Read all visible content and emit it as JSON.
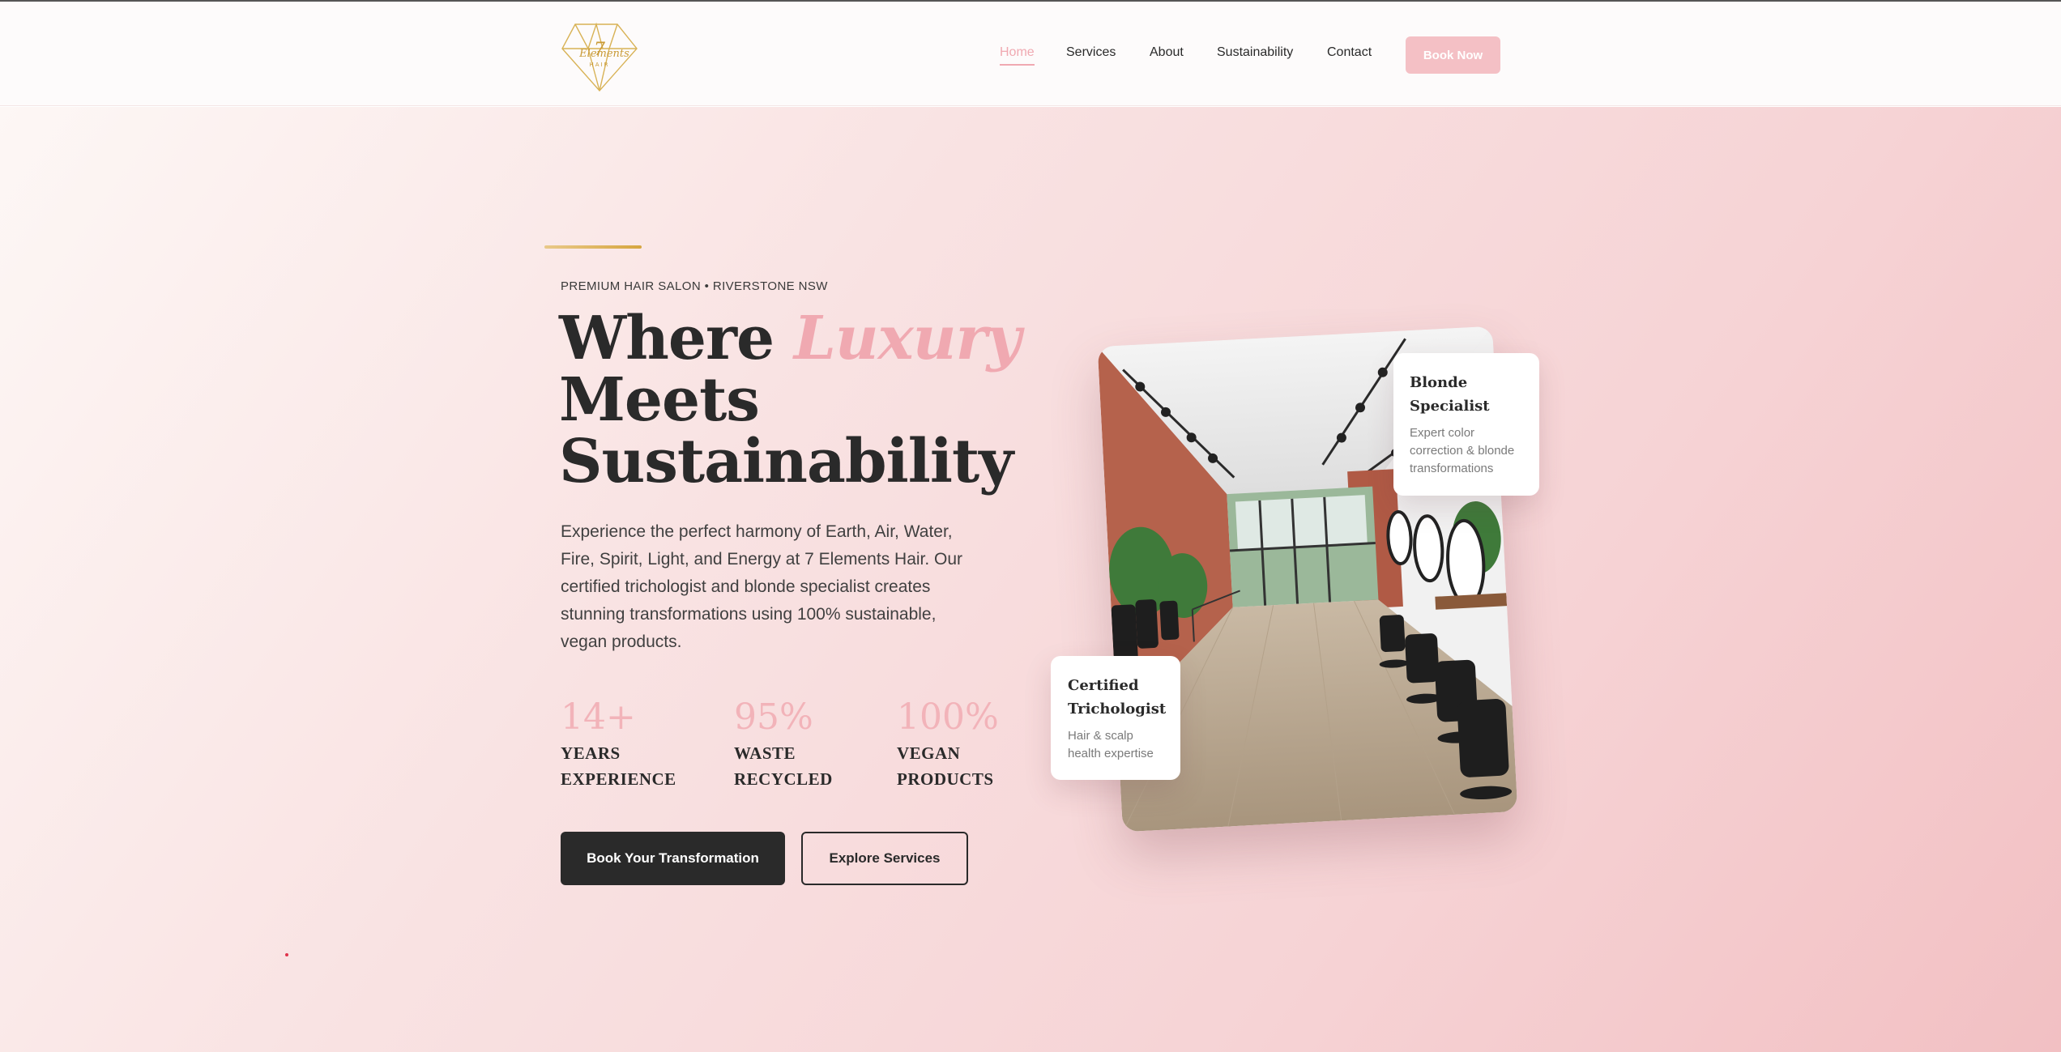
{
  "header": {
    "logo_alt": "7 Elements HAIR",
    "nav": [
      {
        "label": "Home",
        "active": true
      },
      {
        "label": "Services",
        "active": false
      },
      {
        "label": "About",
        "active": false
      },
      {
        "label": "Sustainability",
        "active": false
      },
      {
        "label": "Contact",
        "active": false
      }
    ],
    "cta_label": "Book Now"
  },
  "hero": {
    "eyebrow": "PREMIUM HAIR SALON • RIVERSTONE NSW",
    "headline_line1": "Where ",
    "headline_highlight": "Luxury",
    "headline_line2": "Meets",
    "headline_line3": "Sustainability",
    "intro": "Experience the perfect harmony of Earth, Air, Water, Fire, Spirit, Light, and Energy at 7 Elements Hair. Our certified trichologist and blonde specialist creates stunning transformations using 100% sustainable, vegan products.",
    "stats": [
      {
        "value": "14+",
        "label": "YEARS EXPERIENCE"
      },
      {
        "value": "95%",
        "label": "WASTE RECYCLED"
      },
      {
        "value": "100%",
        "label": "VEGAN PRODUCTS"
      }
    ],
    "primary_cta": "Book Your Transformation",
    "secondary_cta": "Explore Services"
  },
  "cards": {
    "blonde": {
      "title": "Blonde Specialist",
      "text": "Expert color correction & blonde transformations"
    },
    "tricho": {
      "title": "Certified Trichologist",
      "text": "Hair & scalp health expertise"
    }
  },
  "colors": {
    "accent_pink": "#f0a9b1",
    "button_pink": "#f4c0c5",
    "dark": "#2a2a2a",
    "gold": "#d6a640"
  }
}
